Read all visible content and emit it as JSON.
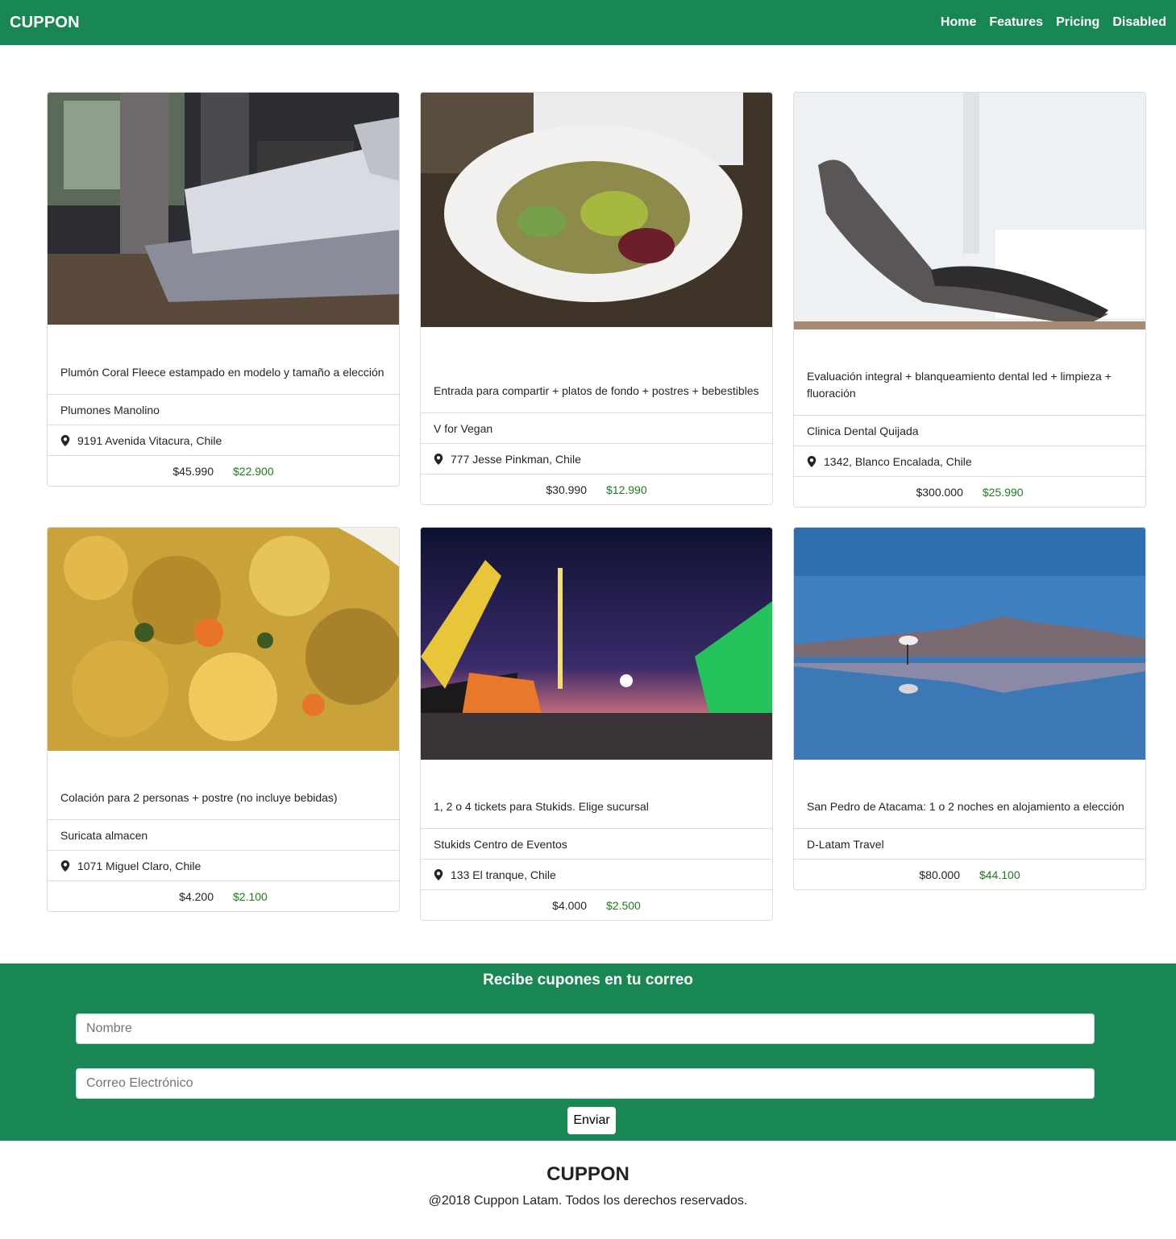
{
  "nav": {
    "brand": "CUPPON",
    "links": [
      "Home",
      "Features",
      "Pricing",
      "Disabled"
    ]
  },
  "cards": [
    {
      "title": "Plumón Coral Fleece estampado en modelo y tamaño a elección",
      "merchant": "Plumones Manolino",
      "address": "9191 Avenida Vitacura, Chile",
      "old_price": "$45.990",
      "new_price": "$22.900",
      "image": "bedroom-photo"
    },
    {
      "title": "Entrada para compartir + platos de fondo + postres + bebestibles",
      "merchant": "V for Vegan",
      "address": "777 Jesse Pinkman, Chile",
      "old_price": "$30.990",
      "new_price": "$12.990",
      "image": "salad-plate-photo"
    },
    {
      "title": "Evaluación integral + blanqueamiento dental led + limpieza + fluoración",
      "merchant": "Clinica Dental Quijada",
      "address": "1342, Blanco Encalada, Chile",
      "old_price": "$300.000",
      "new_price": "$25.990",
      "image": "dental-chair-photo"
    },
    {
      "title": "Colación para 2 personas + postre (no incluye bebidas)",
      "merchant": "Suricata almacen",
      "address": "1071 Miguel Claro, Chile",
      "old_price": "$4.200",
      "new_price": "$2.100",
      "image": "vegetable-dish-photo"
    },
    {
      "title": "1, 2 o 4 tickets para Stukids. Elige sucursal",
      "merchant": "Stukids Centro de Eventos",
      "address": "133 El tranque, Chile",
      "old_price": "$4.000",
      "new_price": "$2.500",
      "image": "fairground-night-photo"
    },
    {
      "title": "San Pedro de Atacama: 1 o 2 noches en alojamiento a elección",
      "merchant": "D-Latam Travel",
      "address": "",
      "old_price": "$80.000",
      "new_price": "$44.100",
      "image": "flamingo-lake-photo"
    }
  ],
  "subscribe": {
    "title": "Recibe cupones en tu correo",
    "name_placeholder": "Nombre",
    "email_placeholder": "Correo Electrónico",
    "submit_label": "Enviar"
  },
  "footer": {
    "brand": "CUPPON",
    "copyright": "@2018 Cuppon Latam. Todos los derechos reservados."
  },
  "colors": {
    "primary_green": "#198754",
    "price_green": "#1f7a1f"
  }
}
